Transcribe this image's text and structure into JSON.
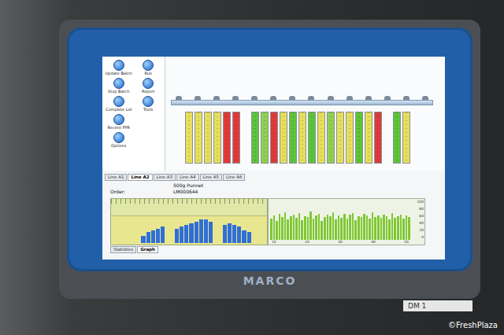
{
  "monitor": {
    "brand": "MARCO",
    "label": "DM 1"
  },
  "watermark": "©FreshPlaza",
  "screen": {
    "sidebar": {
      "items": [
        {
          "label": "Update Batch"
        },
        {
          "label": "Run"
        },
        {
          "label": "Stop Batch"
        },
        {
          "label": "Report"
        },
        {
          "label": "Complete Lot"
        },
        {
          "label": "Tools"
        },
        {
          "label": "Recent PPR"
        },
        {
          "label": ""
        },
        {
          "label": "Options"
        }
      ]
    },
    "lanes": [
      {
        "kind": "bin",
        "color": "#e6df5a"
      },
      {
        "kind": "bin",
        "color": "#e6df5a"
      },
      {
        "kind": "bin",
        "color": "#e6df5a"
      },
      {
        "kind": "bin",
        "color": "#e6df5a"
      },
      {
        "kind": "bin",
        "color": "#e03a3a"
      },
      {
        "kind": "bin",
        "color": "#e03a3a"
      },
      {
        "kind": "gap",
        "color": "#f9fbfc"
      },
      {
        "kind": "bin",
        "color": "#5cc43a"
      },
      {
        "kind": "bin",
        "color": "#8fd14f"
      },
      {
        "kind": "bin",
        "color": "#e03a3a"
      },
      {
        "kind": "bin",
        "color": "#e6df5a"
      },
      {
        "kind": "bin",
        "color": "#5cc43a"
      },
      {
        "kind": "bin",
        "color": "#e6df5a"
      },
      {
        "kind": "bin",
        "color": "#5cc43a"
      },
      {
        "kind": "bin",
        "color": "#e6df5a"
      },
      {
        "kind": "bin",
        "color": "#8fd14f"
      },
      {
        "kind": "bin",
        "color": "#e6df5a"
      },
      {
        "kind": "bin",
        "color": "#e6df5a"
      },
      {
        "kind": "bin",
        "color": "#5cc43a"
      },
      {
        "kind": "bin",
        "color": "#e6df5a"
      },
      {
        "kind": "bin",
        "color": "#e03a3a"
      },
      {
        "kind": "gap",
        "color": "#f9fbfc"
      },
      {
        "kind": "bin",
        "color": "#5cc43a"
      },
      {
        "kind": "bin",
        "color": "#e6df5a"
      }
    ],
    "tabs": [
      {
        "label": "Line A1",
        "selected": false
      },
      {
        "label": "Line A2",
        "selected": true
      },
      {
        "label": "Line A3",
        "selected": false
      },
      {
        "label": "Line A4",
        "selected": false
      },
      {
        "label": "Line A5",
        "selected": false
      },
      {
        "label": "Line A6",
        "selected": false
      }
    ],
    "product": "500g Punnet",
    "order": {
      "label": "Order:",
      "value": "LM000644"
    },
    "histogram": {
      "values": [
        0,
        0,
        0,
        0,
        0,
        8,
        12,
        14,
        16,
        18,
        0,
        0,
        16,
        18,
        20,
        22,
        24,
        26,
        26,
        24,
        0,
        0,
        20,
        22,
        20,
        18,
        14,
        12,
        0,
        0
      ]
    },
    "trend": {
      "values": [
        55,
        62,
        48,
        66,
        58,
        70,
        52,
        60,
        64,
        57,
        68,
        50,
        61,
        59,
        72,
        54,
        63,
        66,
        49,
        58,
        65,
        60,
        71,
        53,
        62,
        57,
        67,
        55,
        64,
        69,
        51,
        60,
        58,
        66,
        62,
        54,
        70,
        59,
        63,
        56,
        65,
        61,
        52,
        68,
        57,
        60,
        64,
        55,
        62,
        58
      ],
      "y_ticks": [
        "100",
        "80",
        "60",
        "40",
        "20",
        "0"
      ],
      "x_ticks": [
        "10",
        "20",
        "30",
        "40",
        "50"
      ]
    },
    "bottom_tabs": [
      {
        "label": "Statistics",
        "selected": false
      },
      {
        "label": "Graph",
        "selected": true
      }
    ]
  }
}
